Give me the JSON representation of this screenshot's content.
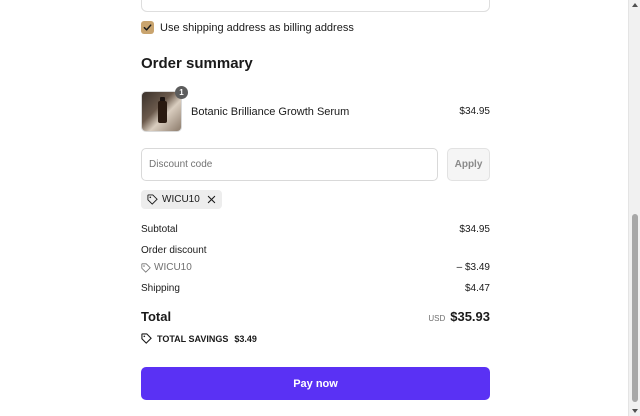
{
  "billing": {
    "same_as_shipping_label": "Use shipping address as billing address",
    "same_as_shipping_checked": true
  },
  "order_summary": {
    "title": "Order summary",
    "item": {
      "name": "Botanic Brilliance Growth Serum",
      "price": "$34.95",
      "quantity": "1"
    },
    "discount": {
      "placeholder": "Discount code",
      "apply_label": "Apply",
      "applied_code": "WICU10"
    },
    "lines": {
      "subtotal_label": "Subtotal",
      "subtotal_value": "$34.95",
      "order_discount_label": "Order discount",
      "discount_code": "WICU10",
      "discount_value": "– $3.49",
      "shipping_label": "Shipping",
      "shipping_value": "$4.47"
    },
    "total": {
      "label": "Total",
      "currency": "USD",
      "amount": "$35.93"
    },
    "savings": {
      "label": "TOTAL SAVINGS",
      "amount": "$3.49"
    },
    "pay_label": "Pay now"
  },
  "colors": {
    "accent": "#5a31f4",
    "checkbox": "#c9a46e"
  }
}
